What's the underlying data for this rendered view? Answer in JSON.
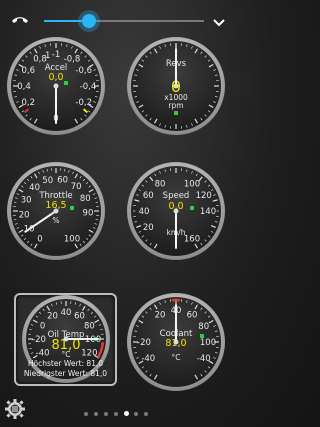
{
  "topbar": {
    "phone_icon": "hangup-phone-icon",
    "slider_level": 0.28,
    "chevron_icon": "chevron-down-icon"
  },
  "gauges": {
    "accel": {
      "name": "Accel",
      "value": "0,0",
      "unit": "",
      "ticks": [
        {
          "t": "-1",
          "a": 0
        },
        {
          "t": "-0,8",
          "a": 30
        },
        {
          "t": "-0,6",
          "a": 60
        },
        {
          "t": "-0,4",
          "a": 90
        },
        {
          "t": "-0,2",
          "a": 120
        },
        {
          "t": "0",
          "a": 180
        },
        {
          "t": "0,2",
          "a": 240
        },
        {
          "t": "0,4",
          "a": 270
        },
        {
          "t": "0,6",
          "a": 300
        },
        {
          "t": "0,8",
          "a": 330
        },
        {
          "t": "1",
          "a": 345
        }
      ]
    },
    "revs": {
      "name": "Revs",
      "value": "0",
      "unit": "x1000\nrpm",
      "ticks": []
    },
    "throttle": {
      "name": "Throttle",
      "value": "16,5",
      "unit": "%",
      "ticks": [
        {
          "t": "0",
          "a": 210
        },
        {
          "t": "10",
          "a": 237
        },
        {
          "t": "20",
          "a": 264
        },
        {
          "t": "30",
          "a": 291
        },
        {
          "t": "40",
          "a": 318
        },
        {
          "t": "50",
          "a": 345
        },
        {
          "t": "60",
          "a": 12
        },
        {
          "t": "70",
          "a": 39
        },
        {
          "t": "80",
          "a": 66
        },
        {
          "t": "90",
          "a": 93
        },
        {
          "t": "100",
          "a": 150
        }
      ]
    },
    "speed": {
      "name": "Speed",
      "value": "0,0",
      "unit": "km/h",
      "ticks": [
        {
          "t": "20",
          "a": 240
        },
        {
          "t": "40",
          "a": 270
        },
        {
          "t": "60",
          "a": 300
        },
        {
          "t": "80",
          "a": 330
        },
        {
          "t": "100",
          "a": 30
        },
        {
          "t": "120",
          "a": 60
        },
        {
          "t": "140",
          "a": 90
        },
        {
          "t": "160",
          "a": 150
        }
      ]
    },
    "oil": {
      "name": "Oil Temp",
      "value": "81,0",
      "unit": "°C",
      "ticks": [
        {
          "t": "-40",
          "a": 240
        },
        {
          "t": "-20",
          "a": 270
        },
        {
          "t": "0",
          "a": 300
        },
        {
          "t": "20",
          "a": 330
        },
        {
          "t": "40",
          "a": 0
        },
        {
          "t": "60",
          "a": 30
        },
        {
          "t": "80",
          "a": 60
        },
        {
          "t": "100",
          "a": 90
        },
        {
          "t": "120",
          "a": 120
        }
      ],
      "max_label": "Höchster Wert: 81,0",
      "min_label": "Niedrigster Wert: 81,0"
    },
    "coolant": {
      "name": "Coolant",
      "value": "81,0",
      "unit": "°C",
      "ticks": [
        {
          "t": "-40",
          "a": 240
        },
        {
          "t": "-20",
          "a": 270
        },
        {
          "t": "20",
          "a": 330
        },
        {
          "t": "40",
          "a": 0
        },
        {
          "t": "60",
          "a": 30
        },
        {
          "t": "80",
          "a": 60
        },
        {
          "t": "100",
          "a": 90
        },
        {
          "t": "-40",
          "a": 120
        }
      ]
    }
  },
  "pager": {
    "count": 7,
    "active_index": 4
  },
  "menu_icon": "gear-menu-icon"
}
